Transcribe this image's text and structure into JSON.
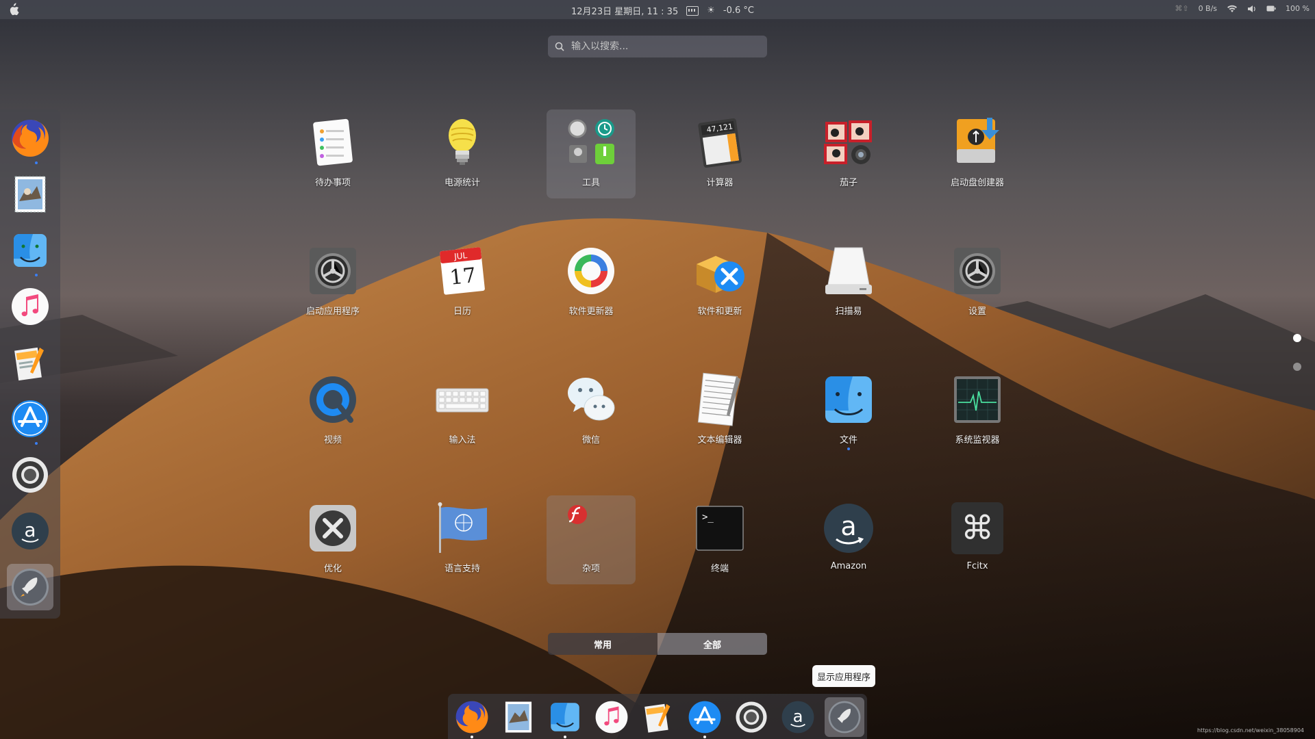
{
  "top_panel": {
    "datetime": "12月23日 星期日, 11 : 35",
    "temperature": "-0.6 °C",
    "shortcut": "⌘⇧",
    "net_speed": "0 B/s",
    "battery": "100 %"
  },
  "search": {
    "placeholder": "输入以搜索..."
  },
  "apps": [
    {
      "label": "待办事项",
      "icon": "reminders-icon"
    },
    {
      "label": "电源统计",
      "icon": "lightbulb-icon"
    },
    {
      "label": "工具",
      "icon": "tools-folder-icon",
      "folder": true
    },
    {
      "label": "计算器",
      "icon": "calculator-icon"
    },
    {
      "label": "茄子",
      "icon": "photo-booth-icon"
    },
    {
      "label": "启动盘创建器",
      "icon": "usb-creator-icon"
    },
    {
      "label": "启动应用程序",
      "icon": "gear-icon"
    },
    {
      "label": "日历",
      "icon": "calendar-icon"
    },
    {
      "label": "软件更新器",
      "icon": "software-updater-icon"
    },
    {
      "label": "软件和更新",
      "icon": "software-update-icon"
    },
    {
      "label": "扫描易",
      "icon": "scanner-icon"
    },
    {
      "label": "设置",
      "icon": "settings-gear-icon"
    },
    {
      "label": "视频",
      "icon": "quicktime-icon"
    },
    {
      "label": "输入法",
      "icon": "keyboard-icon"
    },
    {
      "label": "微信",
      "icon": "wechat-icon"
    },
    {
      "label": "文本编辑器",
      "icon": "text-editor-icon"
    },
    {
      "label": "文件",
      "icon": "finder-icon",
      "running": true
    },
    {
      "label": "系统监视器",
      "icon": "system-monitor-icon"
    },
    {
      "label": "优化",
      "icon": "optimize-tools-icon"
    },
    {
      "label": "语言支持",
      "icon": "language-flag-icon"
    },
    {
      "label": "杂项",
      "icon": "misc-folder-icon",
      "folder": true
    },
    {
      "label": "终端",
      "icon": "terminal-icon"
    },
    {
      "label": "Amazon",
      "icon": "amazon-icon"
    },
    {
      "label": "Fcitx",
      "icon": "command-key-icon"
    }
  ],
  "calendar": {
    "month": "JUL",
    "day": "17"
  },
  "calculator_display": "47,121",
  "terminal_prompt": ">_",
  "tabs": [
    {
      "label": "常用",
      "active": false
    },
    {
      "label": "全部",
      "active": true
    }
  ],
  "tooltip": "显示应用程序",
  "dock_items": [
    {
      "name": "firefox",
      "running": true
    },
    {
      "name": "mail",
      "running": false
    },
    {
      "name": "finder",
      "running": true
    },
    {
      "name": "music",
      "running": false
    },
    {
      "name": "pages",
      "running": false
    },
    {
      "name": "app-store",
      "running": true
    },
    {
      "name": "help",
      "running": false
    },
    {
      "name": "amazon",
      "running": false
    },
    {
      "name": "launchpad",
      "running": false,
      "active": true
    }
  ],
  "page_indicator": {
    "pages": 2,
    "current": 1
  },
  "watermark": "https://blog.csdn.net/weixin_38058904"
}
